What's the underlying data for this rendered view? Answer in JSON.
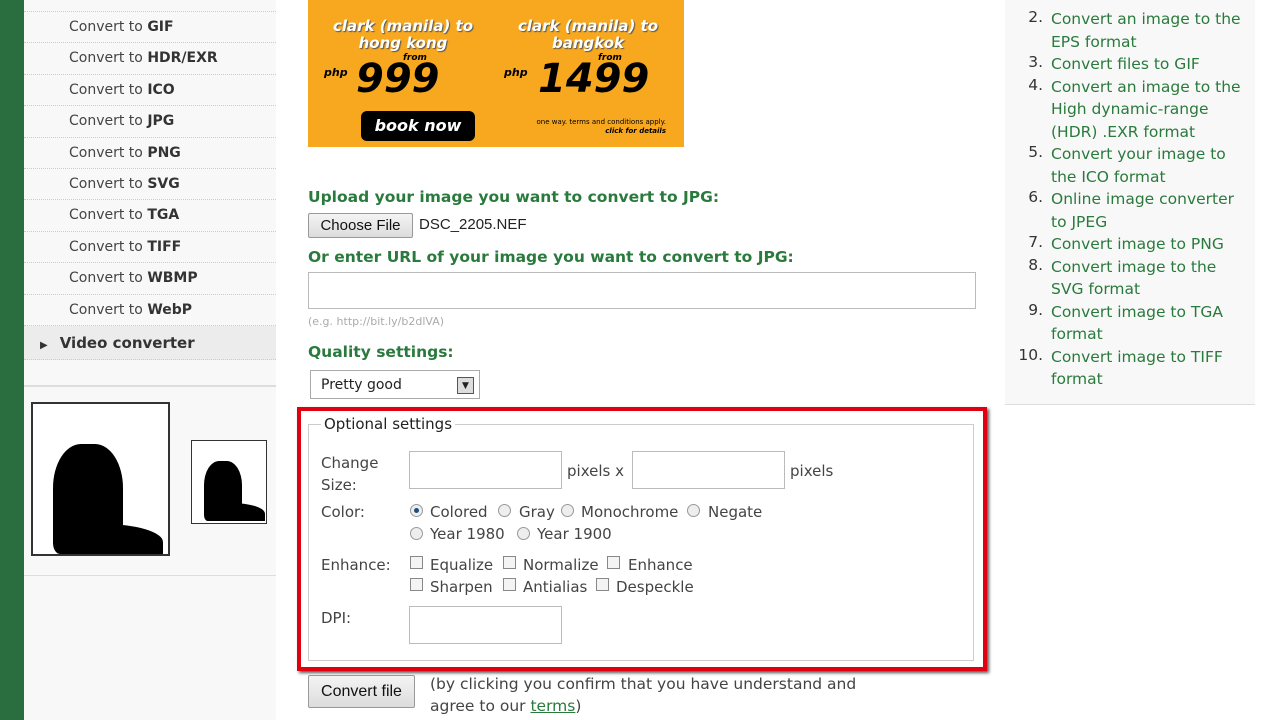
{
  "sidebar": {
    "items": [
      {
        "prefix": "Convert to ",
        "format": "GIF"
      },
      {
        "prefix": "Convert to ",
        "format": "HDR/EXR"
      },
      {
        "prefix": "Convert to ",
        "format": "ICO"
      },
      {
        "prefix": "Convert to ",
        "format": "JPG"
      },
      {
        "prefix": "Convert to ",
        "format": "PNG"
      },
      {
        "prefix": "Convert to ",
        "format": "SVG"
      },
      {
        "prefix": "Convert to ",
        "format": "TGA"
      },
      {
        "prefix": "Convert to ",
        "format": "TIFF"
      },
      {
        "prefix": "Convert to ",
        "format": "WBMP"
      },
      {
        "prefix": "Convert to ",
        "format": "WebP"
      }
    ],
    "video": "Video converter"
  },
  "ad": {
    "route1": "clark (manila) to hong kong",
    "route2": "clark (manila) to bangkok",
    "from": "from",
    "currency": "php",
    "price1": "999",
    "price2": "1499",
    "book": "book now",
    "terms": "one way. terms and conditions apply.",
    "details": "click for details"
  },
  "form": {
    "upload_label": "Upload your image you want to convert to JPG:",
    "choose_file": "Choose File",
    "file_name": "DSC_2205.NEF",
    "url_label": "Or enter URL of your image you want to convert to JPG:",
    "url_value": "",
    "url_hint": "(e.g. http://bit.ly/b2dlVA)",
    "quality_label": "Quality settings:",
    "quality_value": "Pretty good",
    "optional": {
      "legend": "Optional settings",
      "change": "Change",
      "size": "Size:",
      "pixels_x": "pixels x",
      "pixels": "pixels",
      "color_label": "Color:",
      "colors": [
        "Colored",
        "Gray",
        "Monochrome",
        "Negate",
        "Year 1980",
        "Year 1900"
      ],
      "color_selected": "Colored",
      "enhance_label": "Enhance:",
      "enhance": [
        "Equalize",
        "Normalize",
        "Enhance",
        "Sharpen",
        "Antialias",
        "Despeckle"
      ],
      "dpi_label": "DPI:"
    },
    "convert": "Convert file",
    "confirm1": "(by clicking you confirm that you have understand and",
    "confirm2": "agree to our ",
    "terms": "terms",
    "confirm3": ")"
  },
  "highlight_color": "#e00010",
  "right": {
    "items": [
      {
        "n": "2.",
        "text": "Convert an image to the EPS format"
      },
      {
        "n": "3.",
        "text": "Convert files to GIF"
      },
      {
        "n": "4.",
        "text": "Convert an image to the High dynamic-range (HDR) .EXR format"
      },
      {
        "n": "5.",
        "text": "Convert your image to the ICO format"
      },
      {
        "n": "6.",
        "text": "Online image converter to JPEG"
      },
      {
        "n": "7.",
        "text": "Convert image to PNG"
      },
      {
        "n": "8.",
        "text": "Convert image to the SVG format"
      },
      {
        "n": "9.",
        "text": "Convert image to TGA format"
      },
      {
        "n": "10.",
        "text": "Convert image to TIFF format"
      }
    ]
  }
}
